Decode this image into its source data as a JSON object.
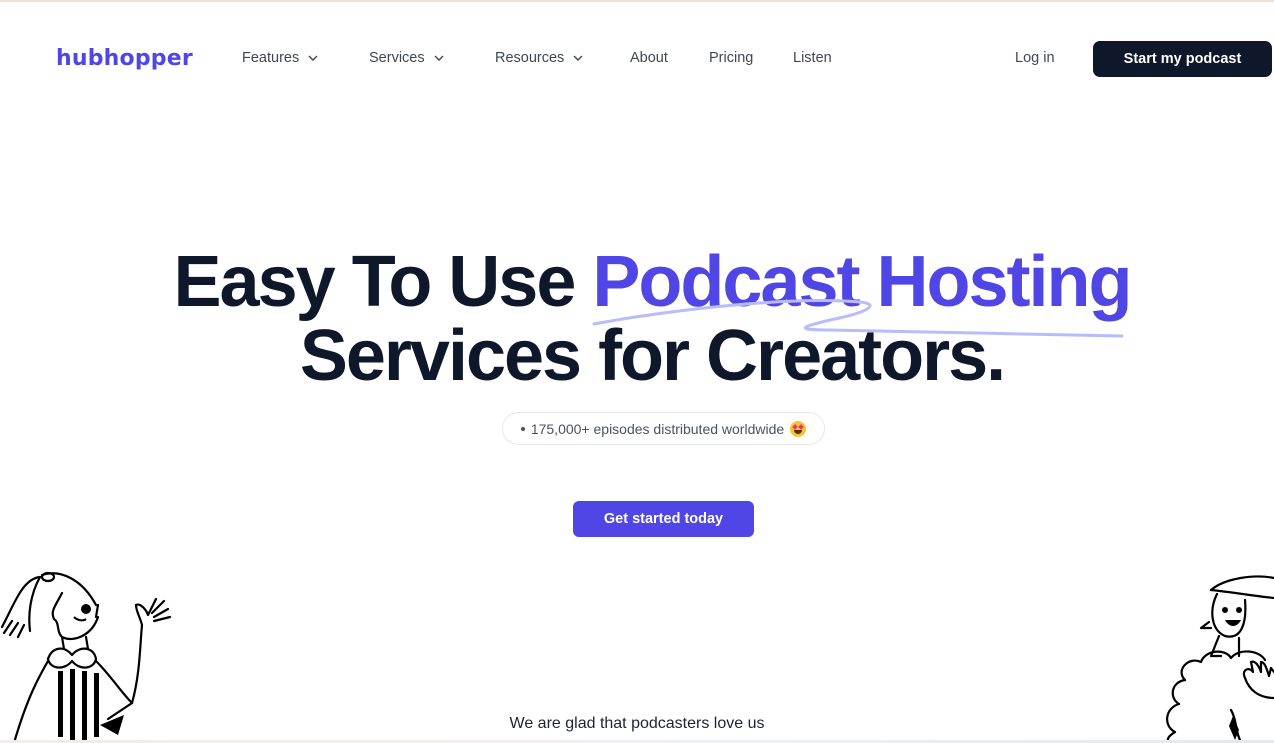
{
  "brand": {
    "name": "hubhopper",
    "accent_color": "#4f46e5",
    "dark_color": "#0f172a"
  },
  "nav": {
    "items": [
      {
        "label": "Features",
        "has_dropdown": true
      },
      {
        "label": "Services",
        "has_dropdown": true
      },
      {
        "label": "Resources",
        "has_dropdown": true
      },
      {
        "label": "About",
        "has_dropdown": false
      },
      {
        "label": "Pricing",
        "has_dropdown": false
      },
      {
        "label": "Listen",
        "has_dropdown": false
      }
    ],
    "login_label": "Log in",
    "cta_label": "Start my podcast"
  },
  "hero": {
    "line1_plain": "Easy To Use ",
    "line1_accent": "Podcast Hosting",
    "line2": "Services for Creators.",
    "badge_text": "175,000+ episodes distributed worldwide",
    "badge_icon": "star-struck-emoji",
    "cta_label": "Get started today"
  },
  "testimonials": {
    "heading": "We are glad that podcasters love us"
  }
}
